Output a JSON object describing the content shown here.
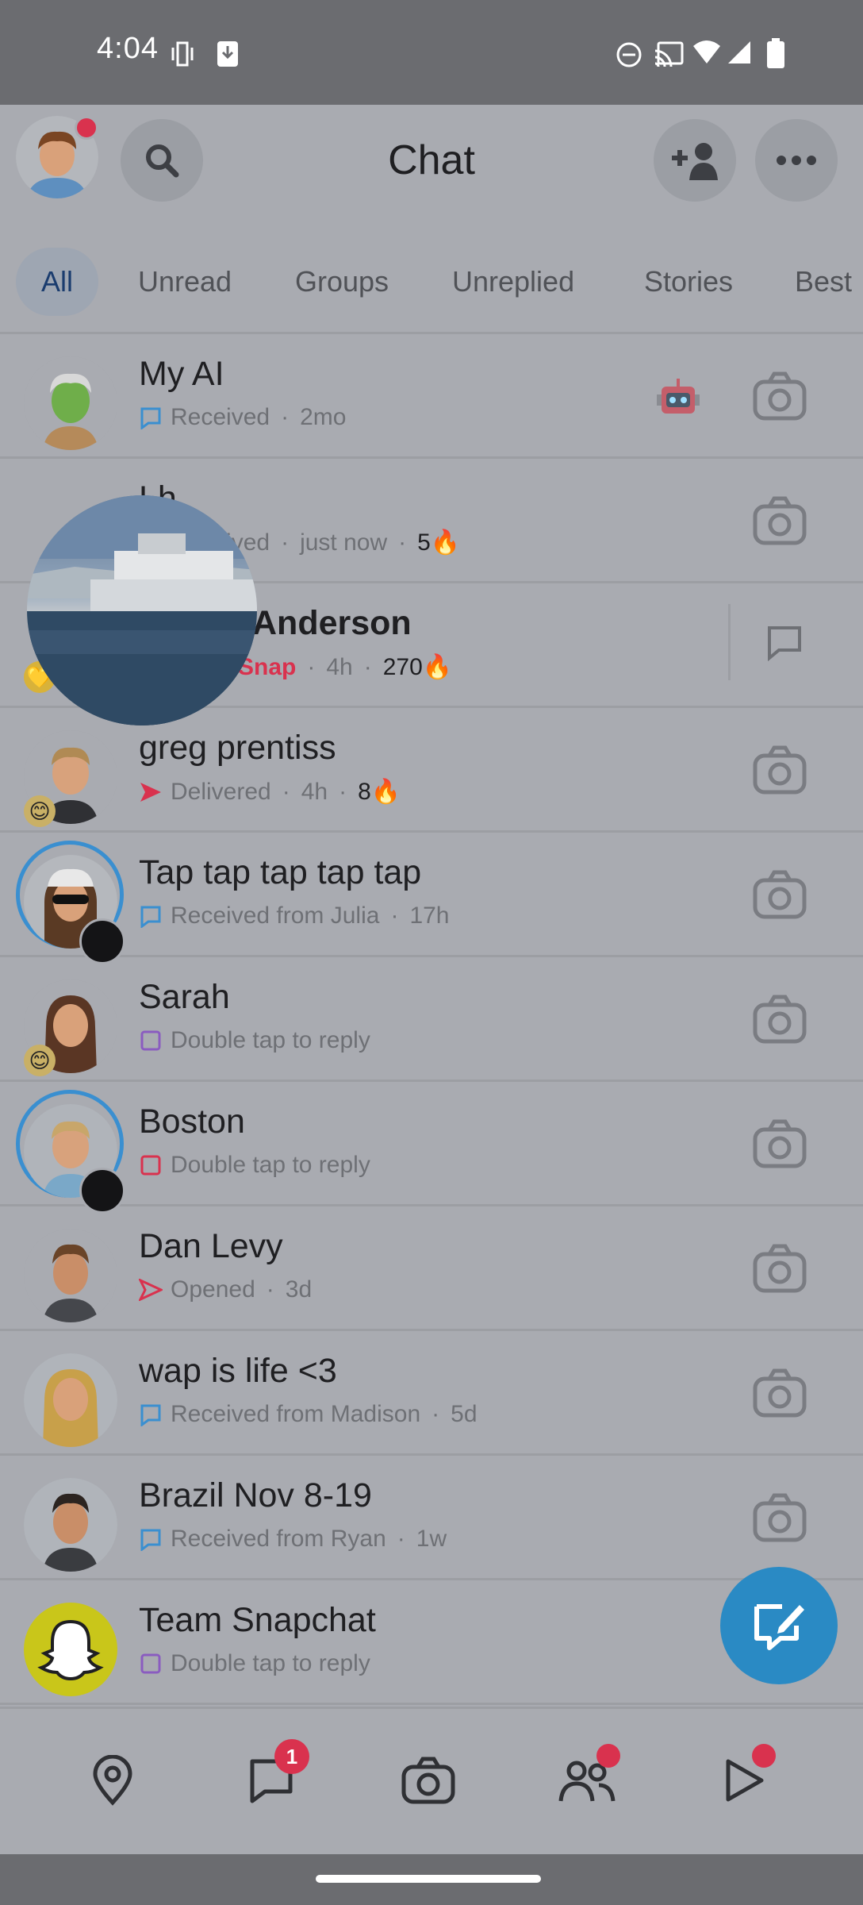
{
  "status_bar": {
    "time": "4:04"
  },
  "header": {
    "title": "Chat"
  },
  "tabs": [
    {
      "label": "All"
    },
    {
      "label": "Unread"
    },
    {
      "label": "Groups"
    },
    {
      "label": "Unreplied"
    },
    {
      "label": "Stories"
    },
    {
      "label": "Best"
    }
  ],
  "chats": [
    {
      "name": "My AI",
      "status": "Received",
      "time": "2mo",
      "streak": "",
      "status_color": "#3a8fd0"
    },
    {
      "name": "Lh",
      "status": "Received",
      "time": "just now",
      "streak": "5",
      "status_color": "#3a8fd0"
    },
    {
      "name": "Anderson",
      "status": "Snap",
      "time": "4h",
      "streak": "270",
      "status_color": "#d9324e"
    },
    {
      "name": "greg prentiss",
      "status": "Delivered",
      "time": "4h",
      "streak": "8",
      "status_color": "#d9324e"
    },
    {
      "name": "Tap tap tap tap tap",
      "status": "Received from Julia",
      "time": "17h",
      "streak": "",
      "status_color": "#3a8fd0"
    },
    {
      "name": "Sarah",
      "status": "Double tap to reply",
      "time": "",
      "streak": "",
      "status_color": "#8a5cc0"
    },
    {
      "name": "Boston",
      "status": "Double tap to reply",
      "time": "",
      "streak": "",
      "status_color": "#d9324e"
    },
    {
      "name": "Dan Levy",
      "status": "Opened",
      "time": "3d",
      "streak": "",
      "status_color": "#d9324e"
    },
    {
      "name": "wap is life <3",
      "status": "Received from Madison",
      "time": "5d",
      "streak": "",
      "status_color": "#3a8fd0"
    },
    {
      "name": "Brazil Nov 8-19",
      "status": "Received from Ryan",
      "time": "1w",
      "streak": "",
      "status_color": "#3a8fd0"
    },
    {
      "name": "Team Snapchat",
      "status": "Double tap to reply",
      "time": "",
      "streak": "",
      "status_color": "#8a5cc0"
    }
  ],
  "bottom_nav": {
    "chat_badge": "1",
    "items": [
      "map-icon",
      "chat-icon",
      "camera-icon",
      "friends-icon",
      "stories-icon"
    ]
  },
  "colors": {
    "accent": "#2a8ac4",
    "notification": "#d9324e"
  }
}
